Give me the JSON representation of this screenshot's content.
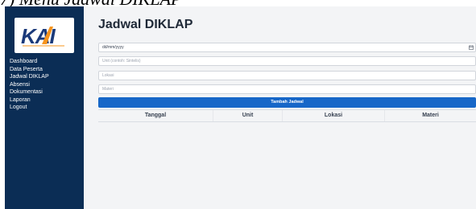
{
  "caption": "7) Menu Jadwal DIKLAP",
  "brand": {
    "logo_text": "KAI",
    "color_navy": "#1b3a7a",
    "color_orange": "#f7941d"
  },
  "sidebar": {
    "items": [
      {
        "label": "Dashboard"
      },
      {
        "label": "Data Peserta"
      },
      {
        "label": "Jadwal DIKLAP"
      },
      {
        "label": "Absensi"
      },
      {
        "label": "Dokumentasi"
      },
      {
        "label": "Laporan"
      },
      {
        "label": "Logout"
      }
    ]
  },
  "page": {
    "title": "Jadwal DIKLAP"
  },
  "form": {
    "date_value": "dd/mm/yyyy",
    "date_icon": "calendar-icon",
    "unit_placeholder": "Unit (contoh: Sintelis)",
    "lokasi_placeholder": "Lokasi",
    "materi_placeholder": "Materi",
    "submit_label": "Tambah Jadwal"
  },
  "table": {
    "headers": [
      "Tanggal",
      "Unit",
      "Lokasi",
      "Materi"
    ]
  },
  "colors": {
    "sidebar_bg": "#0b2d55",
    "primary_button": "#1767c8",
    "background": "#f3f4f6"
  }
}
